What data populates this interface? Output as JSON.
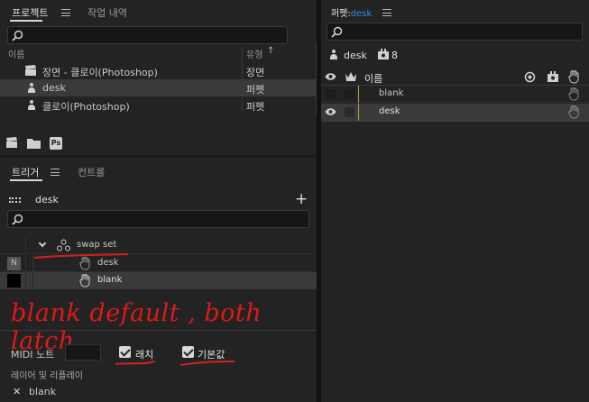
{
  "project": {
    "tabs": [
      "프로젝트",
      "작업 내역"
    ],
    "col_name": "이름",
    "col_type": "유형",
    "col_type_sort": "↑",
    "items": [
      {
        "name": "장면 - 클로이(Photoshop)",
        "type": "장면",
        "icon": "scene-clapper-icon"
      },
      {
        "name": "desk",
        "type": "퍼펫",
        "icon": "puppet-icon"
      },
      {
        "name": "클로이(Photoshop)",
        "type": "퍼펫",
        "icon": "puppet-icon"
      }
    ],
    "footer_ps": "Ps"
  },
  "trigger": {
    "tabs": [
      "트리거",
      "컨트롤"
    ],
    "puppet_name": "desk",
    "add": "+",
    "swap_set_label": "swap set",
    "key_label": "N",
    "swap_items": [
      "desk",
      "blank"
    ],
    "annotation": "blank default , both latch",
    "midi_label": "MIDI 노트",
    "latch_label": "래치",
    "default_label": "기본값",
    "replay_label": "레이어 및 리플레이",
    "replay_item": "blank",
    "replay_x": "✕"
  },
  "puppet": {
    "tab_prefix": "퍼펫:",
    "tab_name": "desk",
    "puppet_name": "desk",
    "count": "8",
    "col_name": "이름",
    "layers": [
      "blank",
      "desk"
    ]
  },
  "colors": {
    "accent": "#2d8ceb",
    "annotation": "#d42020"
  }
}
